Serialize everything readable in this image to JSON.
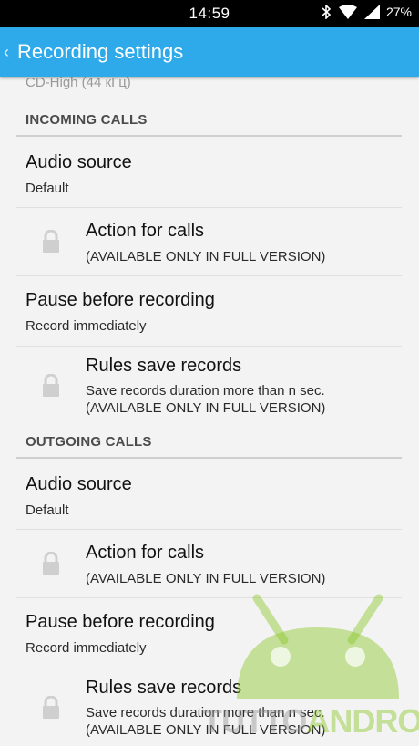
{
  "status_bar": {
    "time": "14:59",
    "battery": "27%",
    "icons": [
      "bluetooth-icon",
      "wifi-icon",
      "signal-icon",
      "battery-icon"
    ]
  },
  "app_bar": {
    "back_glyph": "‹",
    "title": "Recording settings",
    "color": "#2ea9ea"
  },
  "partial_summary": "CD-High (44 кГц)",
  "sections": [
    {
      "header": "INCOMING CALLS",
      "items": [
        {
          "title": "Audio source",
          "summary": "Default",
          "locked": false
        },
        {
          "title": "Action for calls",
          "summary": "(AVAILABLE ONLY IN FULL VERSION)",
          "locked": true
        },
        {
          "title": "Pause before recording",
          "summary": "Record immediately",
          "locked": false
        },
        {
          "title": "Rules save records",
          "summary": "Save records duration more than n sec.",
          "summary2": "(AVAILABLE ONLY IN FULL VERSION)",
          "locked": true
        }
      ]
    },
    {
      "header": "OUTGOING CALLS",
      "items": [
        {
          "title": "Audio source",
          "summary": "Default",
          "locked": false
        },
        {
          "title": "Action for calls",
          "summary": "(AVAILABLE ONLY IN FULL VERSION)",
          "locked": true
        },
        {
          "title": "Pause before recording",
          "summary": "Record immediately",
          "locked": false
        },
        {
          "title": "Rules save records",
          "summary": "Save records duration more than n sec.",
          "summary2": "(AVAILABLE ONLY IN FULL VERSION)",
          "locked": true
        }
      ]
    }
  ],
  "watermark": {
    "part1": "TUTTO",
    "part2": "ANDROID"
  }
}
